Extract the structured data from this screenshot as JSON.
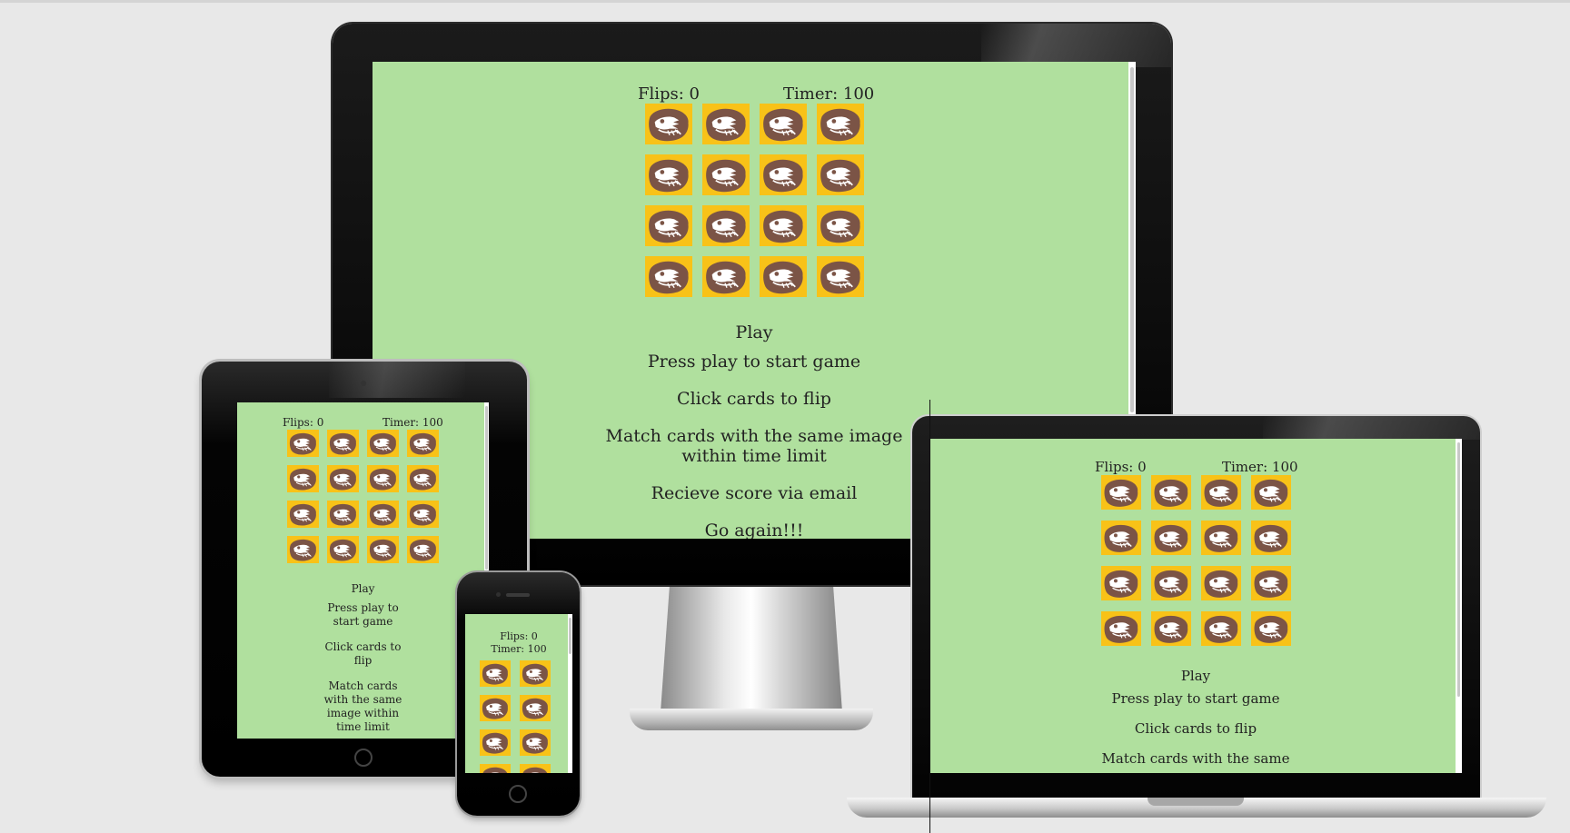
{
  "game": {
    "flips_label": "Flips: 0",
    "timer_label": "Timer: 100",
    "card_icon": "dinosaur-skull-icon",
    "card_count": 16,
    "play_label": "Play",
    "menu": {
      "press_play": "Press play to start game",
      "click_cards": "Click cards to flip",
      "match_cards": "Match cards with the same image within time limit",
      "match_cards_line1": "Match cards with the same image",
      "match_cards_line2": "within time limit",
      "receive_score": "Recieve score via email",
      "go_again": "Go again!!!"
    },
    "tablet_menu": {
      "press_play_l1": "Press play to",
      "press_play_l2": "start game",
      "click_cards_l1": "Click cards to",
      "click_cards_l2": "flip",
      "match_l1": "Match cards",
      "match_l2": "with the same",
      "match_l3": "image within",
      "match_l4": "time limit"
    },
    "laptop_menu": {
      "match_partial": "Match cards with the same"
    }
  },
  "colors": {
    "page_background": "#e8e8e8",
    "screen_background": "#b0e09e",
    "card_background": "#f8c218",
    "card_icon_brown": "#7b5446"
  }
}
